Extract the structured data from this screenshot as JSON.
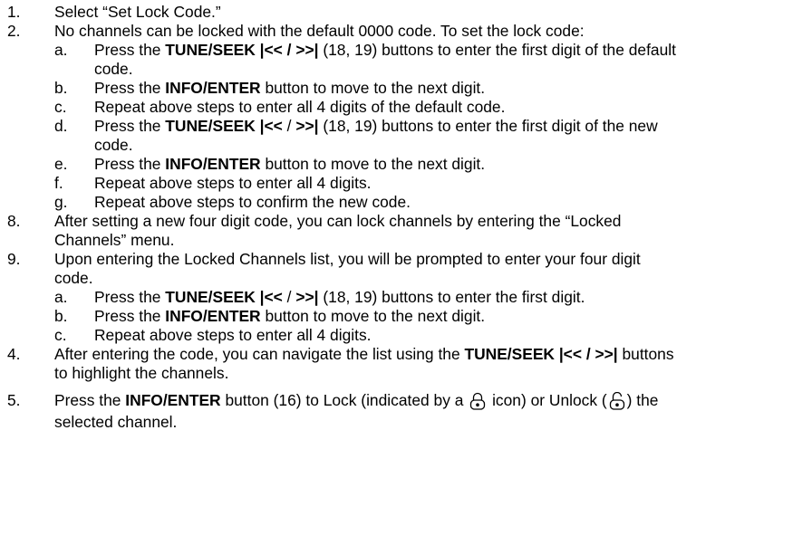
{
  "items": [
    {
      "num": "1.",
      "text": "Select “Set Lock Code.”"
    },
    {
      "num": "2.",
      "text": "No channels can be locked with the default 0000 code. To set the lock code:"
    },
    {
      "num": "8.",
      "line1": "After setting a new four digit code, you can lock channels by entering the “Locked",
      "line2": "Channels” menu."
    },
    {
      "num": "9.",
      "line1": "Upon entering the Locked Channels list, you will be prompted to enter your four digit",
      "line2": "code."
    },
    {
      "num": "4.",
      "line1_pre": "After entering the code, you can navigate the list using the ",
      "line1_bold": "TUNE/SEEK |<< / >>|",
      "line1_post": " buttons",
      "line2": "to highlight the channels."
    },
    {
      "num": "5.",
      "line1_pre": "Press the ",
      "line1_bold": "INFO/ENTER",
      "line1_mid1": " button (16) to Lock (indicated by a ",
      "line1_mid2": " icon) or Unlock (",
      "line1_post": ") the",
      "line2": "selected channel."
    }
  ],
  "sub2": [
    {
      "num": "a.",
      "pre": "Press the ",
      "bold": "TUNE/SEEK |<< / >>|",
      "post": " (18, 19) buttons to enter the first digit of the default",
      "line2": "code."
    },
    {
      "num": "b.",
      "pre": "Press the ",
      "bold": "INFO/ENTER",
      "post": " button to move to the next digit."
    },
    {
      "num": "c.",
      "text": "Repeat above steps to enter all 4 digits of the default code."
    },
    {
      "num": "d.",
      "pre": "Press the ",
      "bold": "TUNE/SEEK |<<",
      "mid": " / ",
      "bold2": ">>|",
      "post": " (18, 19) buttons to enter the first digit of the new",
      "line2": "code."
    },
    {
      "num": "e.",
      "pre": "Press the ",
      "bold": "INFO/ENTER",
      "post": " button to move to the next digit."
    },
    {
      "num": "f.",
      "text": "Repeat above steps to enter all 4 digits."
    },
    {
      "num": "g.",
      "text": "Repeat above steps to confirm the new code."
    }
  ],
  "sub9": [
    {
      "num": "a.",
      "pre": "Press the ",
      "bold": "TUNE/SEEK |<<",
      "mid": " / ",
      "bold2": ">>|",
      "post": " (18, 19) buttons to enter the first digit."
    },
    {
      "num": "b.",
      "pre": "Press the ",
      "bold": "INFO/ENTER",
      "post": " button to move to the next digit."
    },
    {
      "num": "c.",
      "text": "Repeat above steps to enter all 4 digits."
    }
  ],
  "icons": {
    "locked": "lock-closed-icon",
    "unlocked": "lock-open-icon"
  }
}
